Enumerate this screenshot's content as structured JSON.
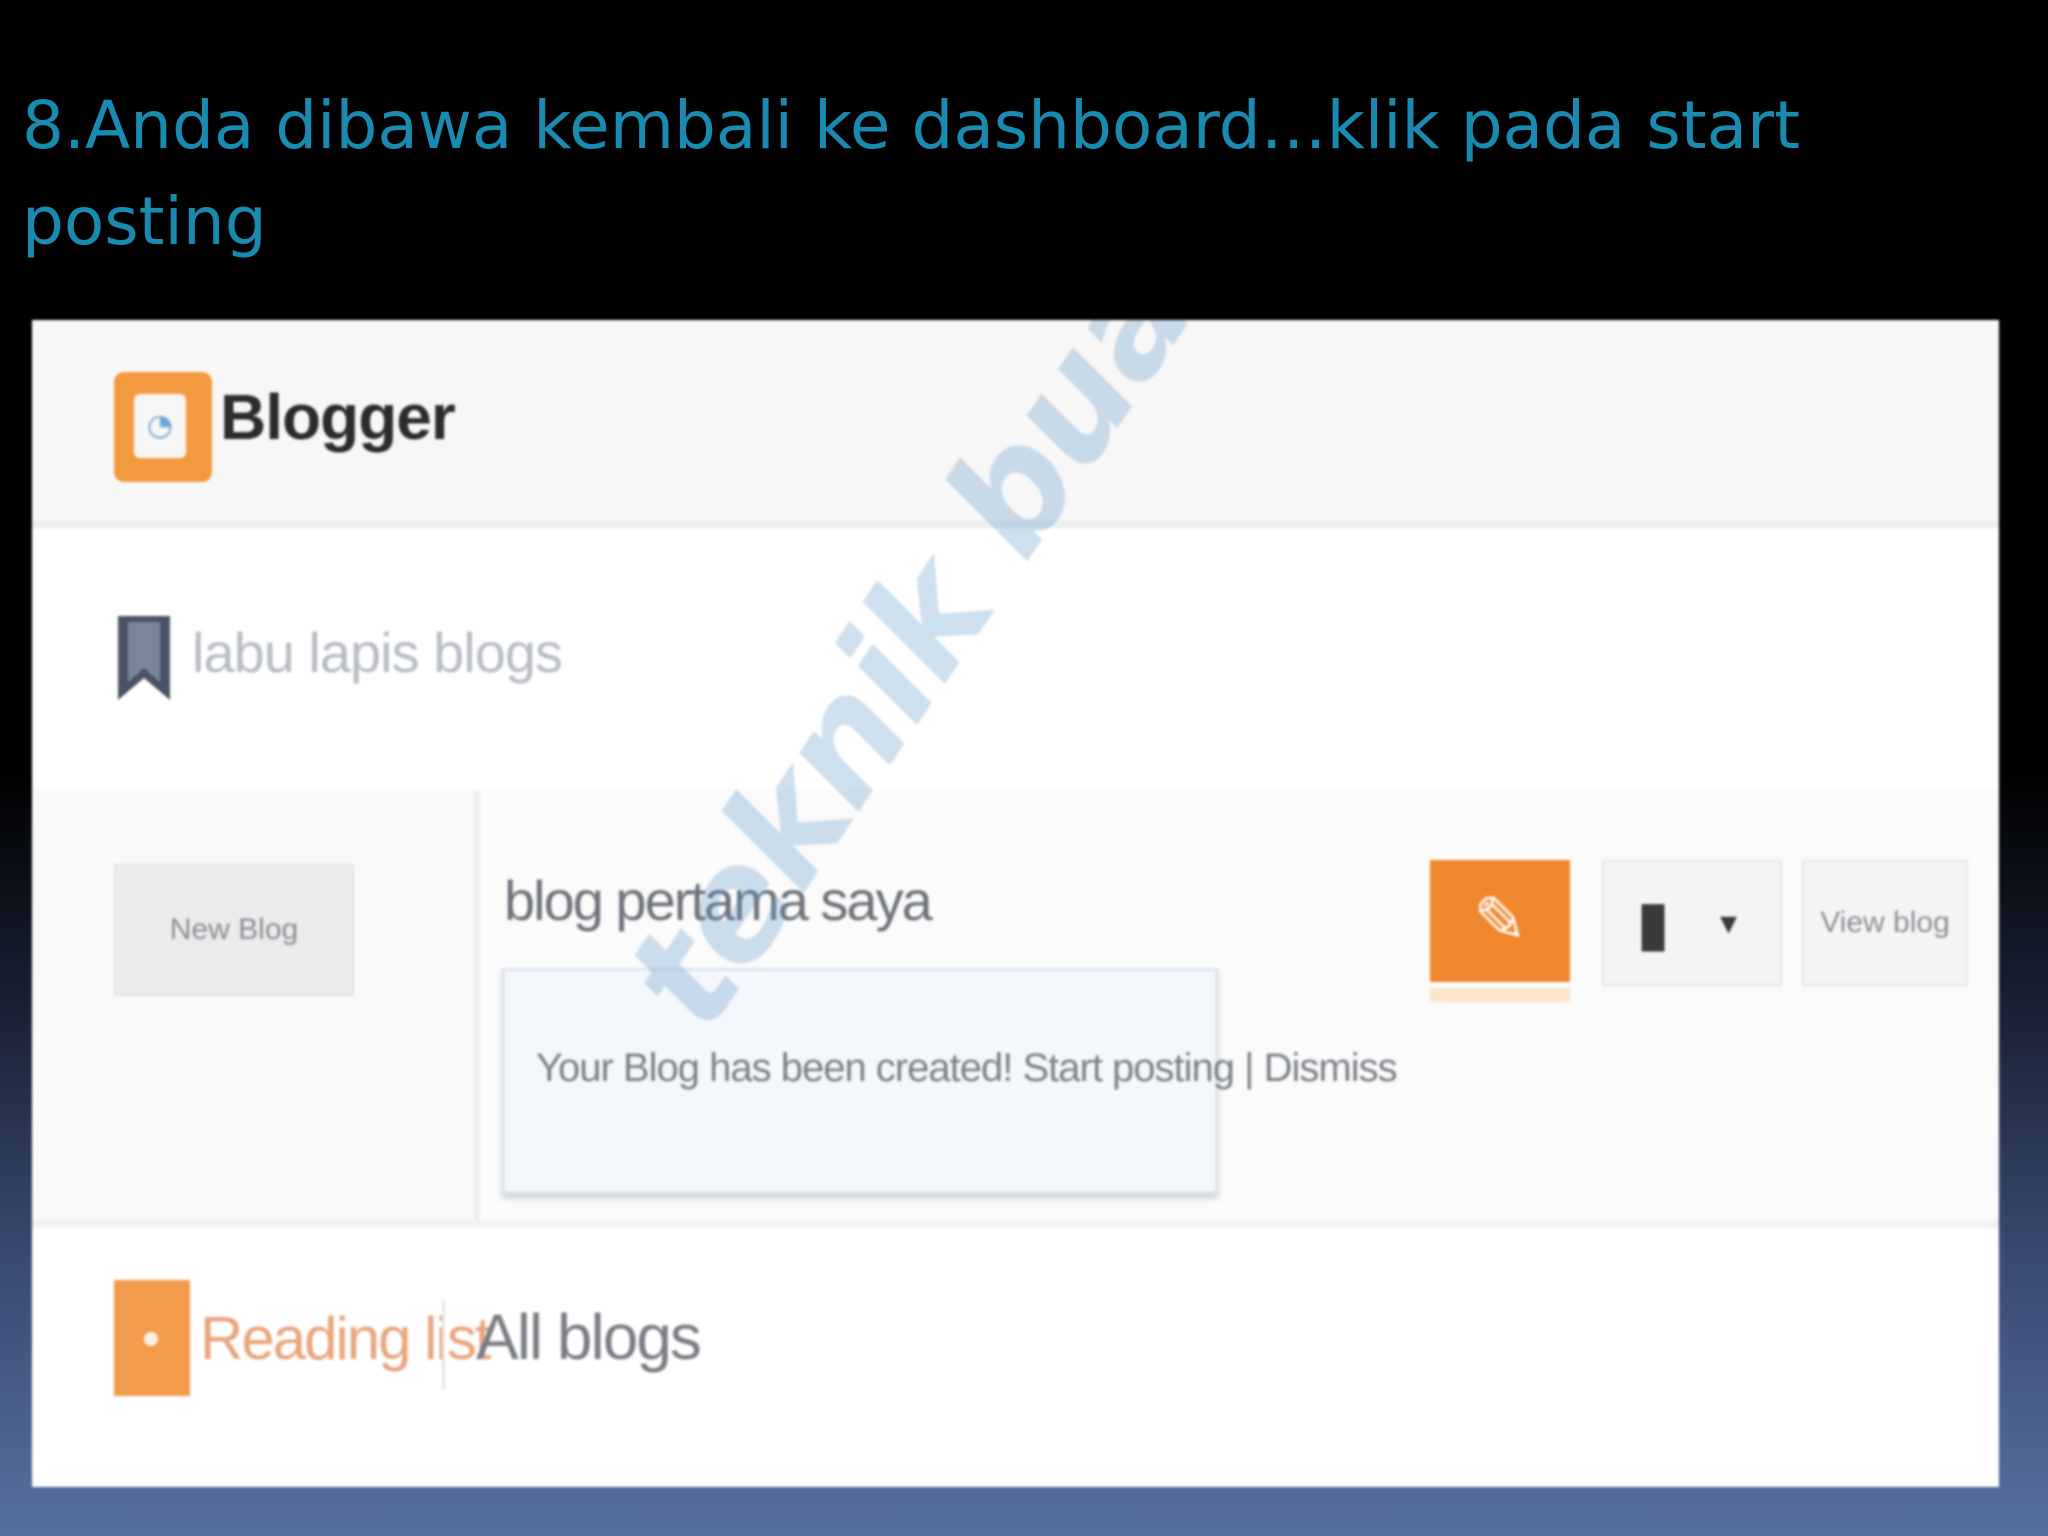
{
  "slide": {
    "title": "8.Anda dibawa kembali ke dashboard…klik pada start posting"
  },
  "blogger": {
    "logo_text": "Blogger",
    "user_blog_label": "labu lapis blogs",
    "new_blog_label": "New Blog",
    "blog_name": "blog pertama saya",
    "notice": "Your Blog has been created! Start posting | Dismiss",
    "view_blog_label": "View blog",
    "reading_list_label": "Reading list",
    "all_blogs_label": "All blogs",
    "watermark": "teknik buat blog",
    "icons": {
      "logo": "blogger-logo-icon",
      "bookmark": "bookmark-icon",
      "edit": "pencil-icon",
      "share": "page-icon",
      "caret": "chevron-down-icon",
      "reading": "reading-list-icon"
    },
    "colors": {
      "accent": "#f0872e",
      "title": "#1a8bb0"
    }
  }
}
